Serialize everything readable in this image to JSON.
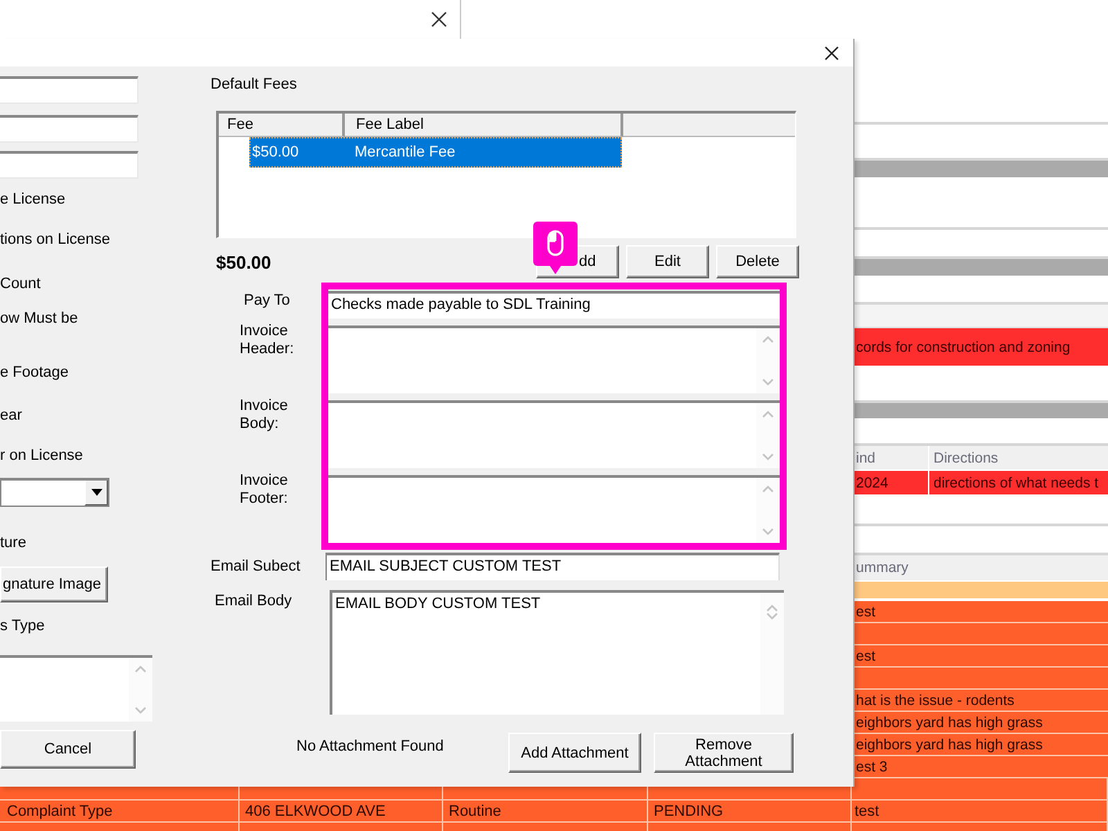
{
  "background": {
    "right_rows": [
      {
        "kind": "plain"
      },
      {
        "kind": "plain"
      },
      {
        "kind": "band"
      },
      {
        "kind": "plain"
      },
      {
        "kind": "plain"
      },
      {
        "kind": "band"
      },
      {
        "kind": "plain"
      },
      {
        "kind": "light"
      },
      {
        "kind": "alert",
        "cells": [
          "cords for construction and zoning"
        ]
      },
      {
        "kind": "plain"
      },
      {
        "kind": "band"
      },
      {
        "kind": "plain"
      },
      {
        "kind": "header",
        "cells": [
          "ind",
          "Directions"
        ]
      },
      {
        "kind": "alert",
        "cells": [
          "2024",
          "directions of what needs t"
        ]
      },
      {
        "kind": "plain"
      },
      {
        "kind": "plain"
      },
      {
        "kind": "header",
        "cells": [
          "ummary"
        ]
      },
      {
        "kind": "peach"
      },
      {
        "kind": "orange",
        "cells": [
          "est"
        ]
      },
      {
        "kind": "orange"
      },
      {
        "kind": "orange",
        "cells": [
          "est"
        ]
      },
      {
        "kind": "orange"
      },
      {
        "kind": "orange",
        "cells": [
          "hat is the issue - rodents"
        ]
      },
      {
        "kind": "orange",
        "cells": [
          "eighbors yard has high grass"
        ]
      },
      {
        "kind": "orange",
        "cells": [
          "eighbors yard has high grass"
        ]
      },
      {
        "kind": "orange",
        "cells": [
          "est 3"
        ]
      }
    ],
    "bottom_rows": [
      {
        "kind": "orange"
      },
      {
        "kind": "orange",
        "cells": [
          "Complaint Type",
          "406 ELKWOOD AVE",
          "Routine",
          "PENDING",
          "test"
        ]
      },
      {
        "kind": "orange"
      }
    ]
  },
  "dialog": {
    "left_panel": [
      {
        "kind": "input"
      },
      {
        "kind": "input"
      },
      {
        "kind": "input"
      },
      {
        "kind": "label",
        "text": "e License"
      },
      {
        "kind": "label",
        "text": "tions on License"
      },
      {
        "kind": "label",
        "text": "Count"
      },
      {
        "kind": "label",
        "text": "ow Must be"
      },
      {
        "kind": "label",
        "text": "e Footage"
      },
      {
        "kind": "label",
        "text": "ear"
      },
      {
        "kind": "label",
        "text": "r on License"
      },
      {
        "kind": "dropdown"
      },
      {
        "kind": "label",
        "text": "ture"
      },
      {
        "kind": "button",
        "text": "gnature Image"
      },
      {
        "kind": "label",
        "text": "s Type"
      },
      {
        "kind": "textarea"
      },
      {
        "kind": "button",
        "text": "Cancel"
      }
    ],
    "default_fees": {
      "title": "Default Fees",
      "columns": [
        "Fee",
        "Fee Label"
      ],
      "rows": [
        {
          "cells": [
            "$50.00",
            "Mercantile Fee"
          ],
          "selected": true
        }
      ],
      "total": "$50.00",
      "buttons": [
        "dd",
        "Edit",
        "Delete"
      ]
    },
    "click_marker": {
      "shown": true
    },
    "invoice": {
      "highlighted": true,
      "fields": [
        {
          "kind": "input",
          "label": "Pay To",
          "value": "Checks made payable to SDL Training"
        },
        {
          "kind": "textarea",
          "label": "Invoice Header:"
        },
        {
          "kind": "textarea",
          "label": "Invoice Body:"
        },
        {
          "kind": "textarea",
          "label": "Invoice Footer:"
        }
      ]
    },
    "email": {
      "subject_label": "Email Subect",
      "subject": "EMAIL SUBJECT CUSTOM TEST",
      "body_label": "Email Body",
      "body": "EMAIL BODY CUSTOM TEST"
    },
    "attachments": {
      "status": "No Attachment Found",
      "buttons": [
        "Add Attachment",
        "Remove Attachment"
      ]
    }
  }
}
